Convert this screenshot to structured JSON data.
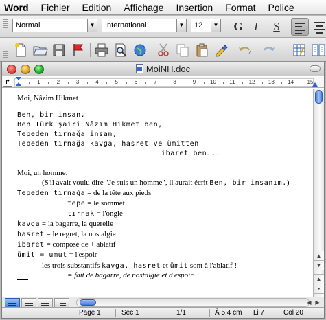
{
  "menubar": {
    "app": "Word",
    "items": [
      "Fichier",
      "Edition",
      "Affichage",
      "Insertion",
      "Format",
      "Police"
    ]
  },
  "format_toolbar": {
    "style": "Normal",
    "font": "International",
    "size": "12",
    "bold": "G",
    "italic": "I",
    "underline": "S"
  },
  "standard_toolbar": {
    "icons": [
      "new-document-icon",
      "open-folder-icon",
      "save-icon",
      "flag-icon",
      "print-icon",
      "print-preview-icon",
      "web-icon",
      "cut-icon",
      "copy-icon",
      "paste-icon",
      "format-painter-icon",
      "undo-icon",
      "redo-icon",
      "table-icon",
      "columns-icon"
    ]
  },
  "window": {
    "title": "MoiNH.doc",
    "colors": {
      "close": "#e0443e",
      "minimize": "#dea123",
      "zoom": "#1aab29"
    }
  },
  "ruler": {
    "tab_selector": "↱",
    "numbers": [
      "1",
      "2",
      "3",
      "4",
      "5",
      "6",
      "7",
      "8",
      "9",
      "10",
      "11",
      "12",
      "13",
      "14",
      "15"
    ]
  },
  "document": {
    "lines": [
      {
        "text": "Moi, Nâzim Hikmet",
        "style": "serif"
      },
      {
        "text": "Ben, bir insan.",
        "style": "mono"
      },
      {
        "text": "Ben Türk şairi Nâzım Hikmet ben,",
        "style": "mono"
      },
      {
        "text": "Tepeden tırnağa insan,",
        "style": "mono"
      },
      {
        "text": "Tepeden tırnağa kavga, hasret ve ümitten",
        "style": "mono"
      },
      {
        "text": "ibaret ben...",
        "style": "mono"
      },
      {
        "text": "Moi, un homme.",
        "style": "serif"
      },
      {
        "text_a": "(S'il avait voulu dire \"Je suis un homme\", il aurait écrit ",
        "text_b": "Ben, bir insanım.",
        "text_c": ")",
        "style": "mixed"
      },
      {
        "text_a": "Tepeden tırnağa",
        "text_b": " = de la tête aux pieds",
        "style": "mixed"
      },
      {
        "text_a": "tepe",
        "text_b": " = le sommet",
        "style": "mixed"
      },
      {
        "text_a": "tırnak",
        "text_b": " = l'ongle",
        "style": "mixed"
      },
      {
        "text_a": "kavga",
        "text_b": " = la bagarre, la querelle",
        "style": "mixed"
      },
      {
        "text_a": "hasret",
        "text_b": " = le regret, la nostalgie",
        "style": "mixed"
      },
      {
        "text_a": "ibaret",
        "text_b": " = composé de + ablatif",
        "style": "mixed"
      },
      {
        "text_a": "ümit = umut",
        "text_b": " = l'espoir",
        "style": "mixed"
      },
      {
        "text_a": "les trois substantifs ",
        "text_b": "kavga, hasret",
        "text_c": " et ",
        "text_d": "ümit",
        "text_e": " sont à l'ablatif !",
        "style": "mixed"
      },
      {
        "text": "= fait de bagarre, de nostalgie et d'espoir",
        "style": "italic"
      }
    ]
  },
  "status": {
    "page": "Page 1",
    "section": "Sec 1",
    "pages": "1/1",
    "position": "À 5,4 cm",
    "line": "Li 7",
    "column": "Col 20"
  }
}
